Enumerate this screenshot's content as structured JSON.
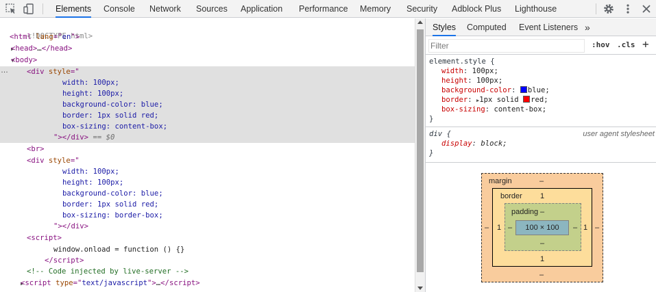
{
  "toolbar": {
    "tabs": [
      "Elements",
      "Console",
      "Network",
      "Sources",
      "Application",
      "Performance",
      "Memory",
      "Security",
      "Adblock Plus",
      "Lighthouse"
    ],
    "active_tab": "Elements",
    "icons": [
      "inspect-icon",
      "device-toolbar-icon",
      "settings-gear-icon",
      "more-vertical-icon",
      "close-icon"
    ]
  },
  "elements": {
    "doctype": "<!DOCTYPE html>",
    "html_tag": "html",
    "lang_attr": "lang",
    "lang_val": "en",
    "head_tag": "head",
    "ellipsis": "…",
    "body_tag": "body",
    "div_tag": "div",
    "style_attr": "style",
    "div1_lines": [
      "width: 100px;",
      "height: 100px;",
      "background-color: blue;",
      "border: 1px solid red;",
      "box-sizing: content-box;"
    ],
    "eq_marker": "== $0",
    "br_tag": "br",
    "div2_lines": [
      "width: 100px;",
      "height: 100px;",
      "background-color: blue;",
      "border: 1px solid red;",
      "box-sizing: border-box;"
    ],
    "script_tag": "script",
    "script_body": "window.onload = function () {}",
    "comment": "<!-- Code injected by live-server -->",
    "type_attr": "type",
    "type_val": "text/javascript",
    "selected_row_dots": "…"
  },
  "styles_pane": {
    "tabs": [
      "Styles",
      "Computed",
      "Event Listeners"
    ],
    "active_tab": "Styles",
    "more_tabs": "»",
    "filter_placeholder": "Filter",
    "hov_label": ":hov",
    "cls_label": ".cls",
    "add_label": "+",
    "element_style_selector": "element.style {",
    "element_style": [
      {
        "prop": "width",
        "value": "100px;"
      },
      {
        "prop": "height",
        "value": "100px;"
      },
      {
        "prop": "background-color",
        "value": "blue;",
        "swatch": "#0000ff"
      },
      {
        "prop": "border",
        "value": "1px solid",
        "value2": "red;",
        "swatch": "#ff0000"
      },
      {
        "prop": "box-sizing",
        "value": "content-box;"
      }
    ],
    "close_brace": "}",
    "ua_selector": "div {",
    "ua_source": "user agent stylesheet",
    "ua_prop": "display",
    "ua_value": "block;"
  },
  "box_model": {
    "margin_label": "margin",
    "margin_top": "–",
    "margin_bottom": "–",
    "margin_left": "–",
    "margin_right": "–",
    "border_label": "border",
    "border_top": "1",
    "border_bottom": "1",
    "border_left": "1",
    "border_right": "1",
    "padding_label": "padding",
    "padding_top": "–",
    "padding_bottom": "–",
    "padding_left": "–",
    "padding_right": "–",
    "content": "100 × 100"
  }
}
